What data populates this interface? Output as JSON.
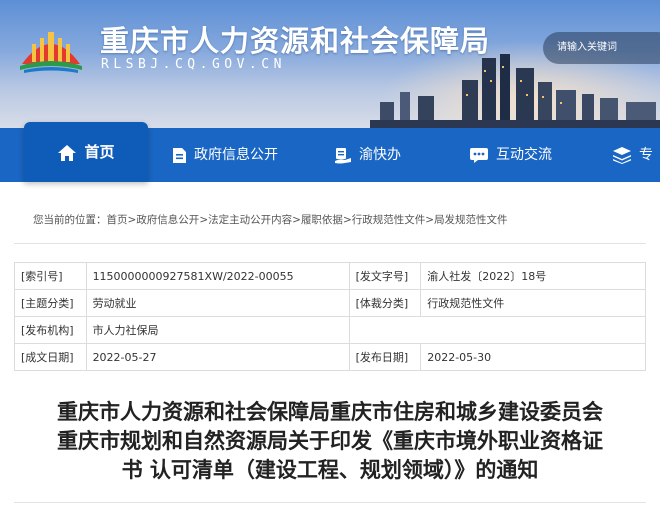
{
  "header": {
    "site_title": "重庆市人力资源和社会保障局",
    "site_domain": "RLSBJ.CQ.GOV.CN",
    "search_placeholder": "请输入关键词"
  },
  "nav": {
    "items": [
      {
        "label": "首页",
        "icon": "home-icon",
        "active": true
      },
      {
        "label": "政府信息公开",
        "icon": "document-icon"
      },
      {
        "label": "渝快办",
        "icon": "service-icon"
      },
      {
        "label": "互动交流",
        "icon": "chat-icon"
      },
      {
        "label": "专",
        "icon": "layers-icon"
      }
    ]
  },
  "breadcrumb": {
    "prefix": "您当前的位置：",
    "items": [
      "首页",
      "政府信息公开",
      "法定主动公开内容",
      "履职依据",
      "行政规范性文件",
      "局发规范性文件"
    ],
    "separator": ">"
  },
  "info": {
    "index_label": "[索引号]",
    "index_value": "115000000092758​1XW/2022-00055",
    "doc_no_label": "[发文字号]",
    "doc_no_value": "渝人社发〔2022〕18号",
    "topic_label": "[主题分类]",
    "topic_value": "劳动就业",
    "genre_label": "[体裁分类]",
    "genre_value": "行政规范性文件",
    "org_label": "[发布机构]",
    "org_value": "市人力社保局",
    "created_label": "[成文日期]",
    "created_value": "2022-05-27",
    "published_label": "[发布日期]",
    "published_value": "2022-05-30"
  },
  "document": {
    "title_lines": [
      "重庆市人力资源和社会保障局重庆市住房和城乡建设委员会",
      "重庆市规划和自然资源局关于印发《重庆市境外职业资格证",
      "书 认可清单（建设工程、规划领域）》的通知"
    ]
  }
}
